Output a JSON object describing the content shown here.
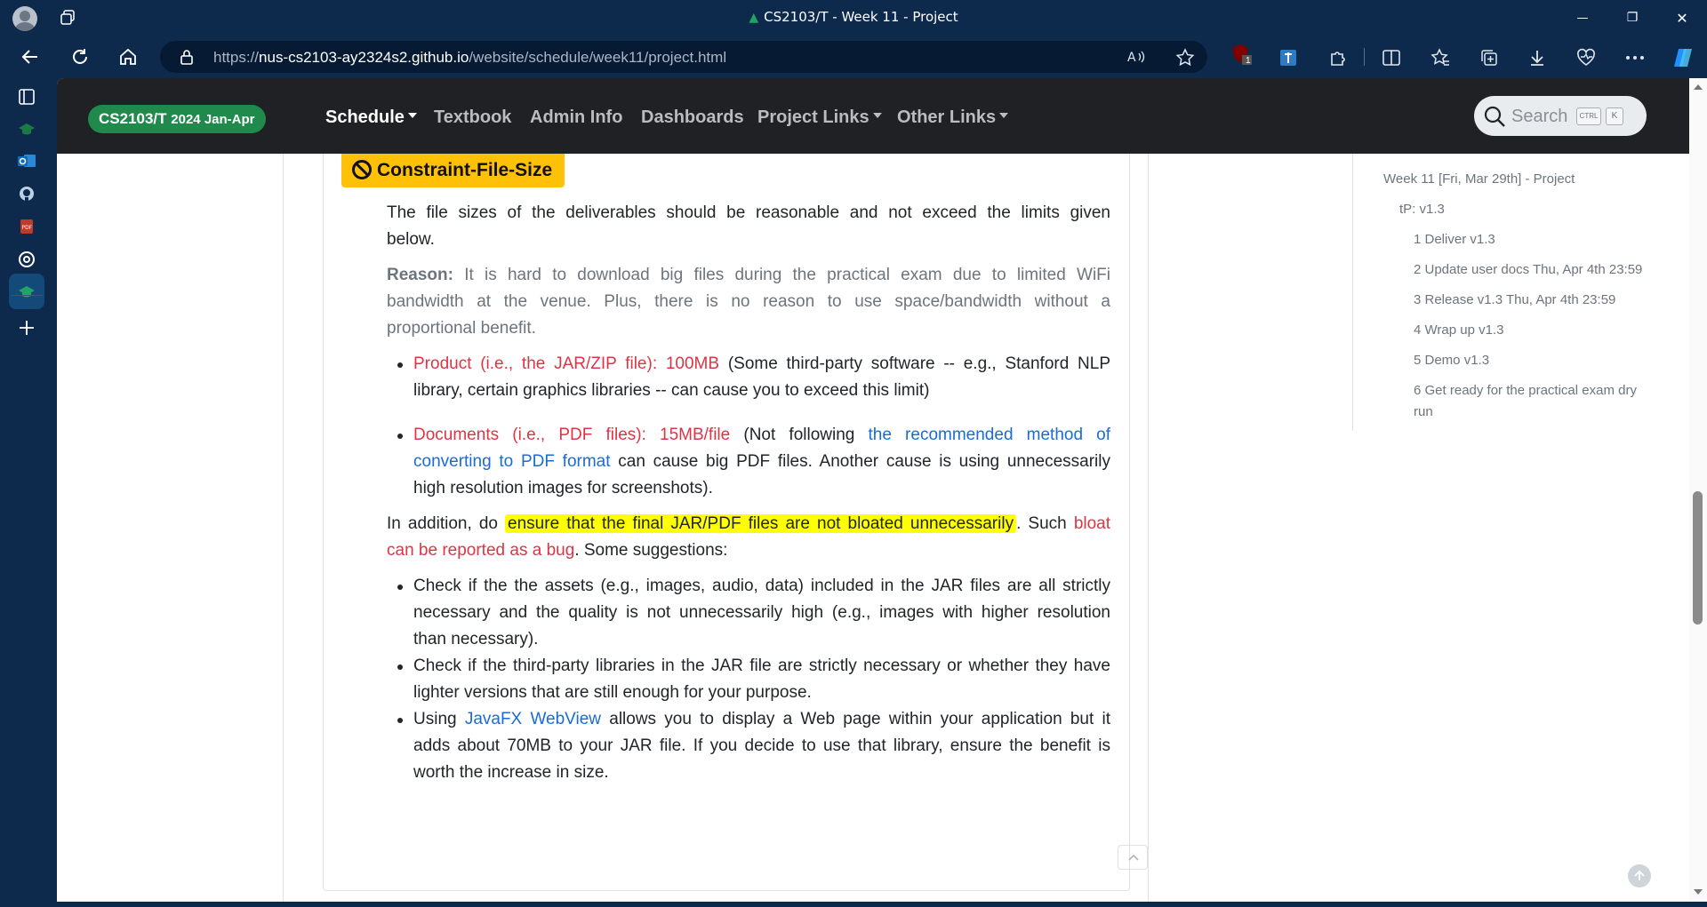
{
  "window": {
    "title": "CS2103/T - Week 11 - Project",
    "buttons": {
      "minimize": "—",
      "restore": "❐",
      "close": "✕"
    }
  },
  "address_bar": {
    "url_prefix": "https://",
    "url_host": "nus-cs2103-ay2324s2.github.io",
    "url_path": "/website/schedule/week11/project.html"
  },
  "toolbar": {
    "extension_badge": "1"
  },
  "sidebar_icons": [
    "tabs-icon",
    "graduation-cap-icon",
    "outlook-icon",
    "github-icon",
    "pdf-icon",
    "at-sign-icon",
    "graduation-cap-icon-active",
    "add-icon"
  ],
  "site_nav": {
    "brand_main": "CS2103/T",
    "brand_sub": "2024 Jan-Apr",
    "links": [
      "Schedule",
      "Textbook",
      "Admin Info",
      "Dashboards",
      "Project Links",
      "Other Links"
    ],
    "search_label": "Search",
    "kbd_ctrl": "CTRL",
    "kbd_k": "K"
  },
  "content": {
    "badge": "Constraint-File-Size",
    "intro_1": "The file sizes of the deliverables should be reasonable and not exceed the limits given",
    "intro_2": "below.",
    "reason_label": "Reason:",
    "reason_1": "It is hard to download big files during the practical exam due to limited WiFi",
    "reason_2": "bandwidth at the venue. Plus, there is no reason to use space/bandwidth without a",
    "reason_3": "proportional benefit.",
    "limit1_red": "Product (i.e., the JAR/ZIP file): 100MB",
    "limit1_rest": "(Some third-party software -- e.g., Stanford NLP",
    "limit1_line2": "library, certain graphics libraries -- can cause you to exceed this limit)",
    "limit2_red": "Documents (i.e., PDF files): 15MB/file",
    "limit2_mid": "(Not following",
    "limit2_link1": "the recommended method of",
    "limit2_link2": "converting to PDF format",
    "limit2_rest": "can cause big PDF files. Another cause is using unnecessarily",
    "limit2_line3": "high resolution images for screenshots).",
    "addition_pre": "In addition, do",
    "addition_hl": "ensure that the final JAR/PDF files are not bloated unnecessarily",
    "addition_post": ". Such",
    "addition_red1": "bloat",
    "addition_red2": "can be reported as a bug",
    "addition_end": ". Some suggestions:",
    "sug1_l1": "Check if the the assets (e.g., images, audio, data) included in the JAR files are all strictly",
    "sug1_l2": "necessary and the quality is not unnecessarily high (e.g., images with higher resolution",
    "sug1_l3": "than necessary).",
    "sug2_l1": "Check if the third-party libraries in the JAR file are strictly necessary or whether they have",
    "sug2_l2": "lighter versions that are still enough for your purpose.",
    "sug3_pre": "Using",
    "sug3_link": "JavaFX WebView",
    "sug3_rest": "allows you to display a Web page within your application but it",
    "sug3_l2": "adds about 70MB to your JAR file. If you decide to use that library, ensure the benefit is",
    "sug3_l3": "worth the increase in size."
  },
  "toc": {
    "week": "Week 11 [Fri, Mar 29th] - Project",
    "tp": "tP: v1.3",
    "items": [
      "1 Deliver v1.3",
      "2 Update user docs Thu, Apr 4th 23:59",
      "3 Release v1.3 Thu, Apr 4th 23:59",
      "4 Wrap up v1.3",
      "5 Demo v1.3",
      "6 Get ready for the practical exam dry",
      "run"
    ]
  },
  "colors": {
    "browser_frame": "#0d2a4d",
    "site_nav": "#1f2124",
    "brand_green": "#1f8a4c",
    "badge_warning": "#ffc107",
    "highlight": "#ffff00",
    "danger_text": "#dc3545",
    "link": "#1a6bd6"
  }
}
